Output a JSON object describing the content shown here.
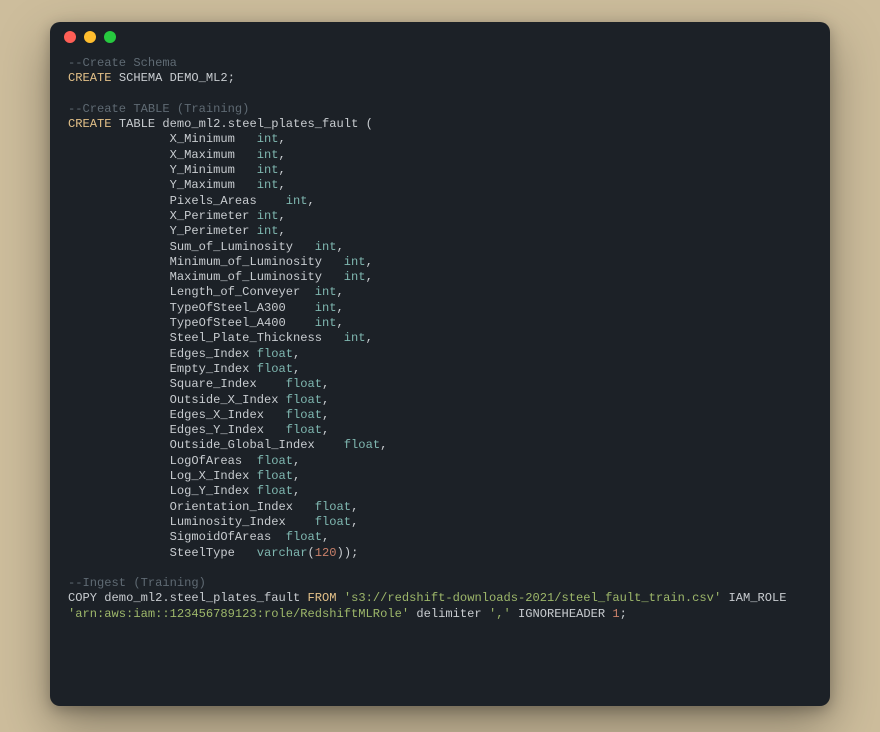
{
  "comments": {
    "schema": "--Create Schema",
    "table": "--Create TABLE (Training)",
    "ingest": "--Ingest (Training)"
  },
  "kw": {
    "create": "CREATE",
    "schema": "SCHEMA",
    "table": "TABLE",
    "copy": "COPY",
    "from": "FROM",
    "iam_role": "IAM_ROLE",
    "delimiter": "delimiter",
    "ignoreheader": "IGNOREHEADER"
  },
  "schema_name": "DEMO_ML2",
  "table_name": "demo_ml2.steel_plates_fault",
  "types": {
    "int": "int",
    "float": "float",
    "varchar": "varchar"
  },
  "varchar_len": "120",
  "cols": {
    "x_min": "X_Minimum",
    "x_max": "X_Maximum",
    "y_min": "Y_Minimum",
    "y_max": "Y_Maximum",
    "pixels_areas": "Pixels_Areas",
    "x_perim": "X_Perimeter",
    "y_perim": "Y_Perimeter",
    "sum_lum": "Sum_of_Luminosity",
    "min_lum": "Minimum_of_Luminosity",
    "max_lum": "Maximum_of_Luminosity",
    "len_conv": "Length_of_Conveyer",
    "steel_a300": "TypeOfSteel_A300",
    "steel_a400": "TypeOfSteel_A400",
    "thickness": "Steel_Plate_Thickness",
    "edges_idx": "Edges_Index",
    "empty_idx": "Empty_Index",
    "square_idx": "Square_Index",
    "out_x_idx": "Outside_X_Index",
    "edges_x_idx": "Edges_X_Index",
    "edges_y_idx": "Edges_Y_Index",
    "out_global_idx": "Outside_Global_Index",
    "log_areas": "LogOfAreas",
    "log_x_idx": "Log_X_Index",
    "log_y_idx": "Log_Y_Index",
    "orient_idx": "Orientation_Index",
    "lum_idx": "Luminosity_Index",
    "sigmoid": "SigmoidOfAreas",
    "steel_type": "SteelType"
  },
  "copy_target": "demo_ml2.steel_plates_fault",
  "s3_path": "'s3://redshift-downloads-2021/steel_fault_train.csv'",
  "iam_arn": "'arn:aws:iam::123456789123:role/RedshiftMLRole'",
  "delimiter_val": "','",
  "ignoreheader_val": "1"
}
